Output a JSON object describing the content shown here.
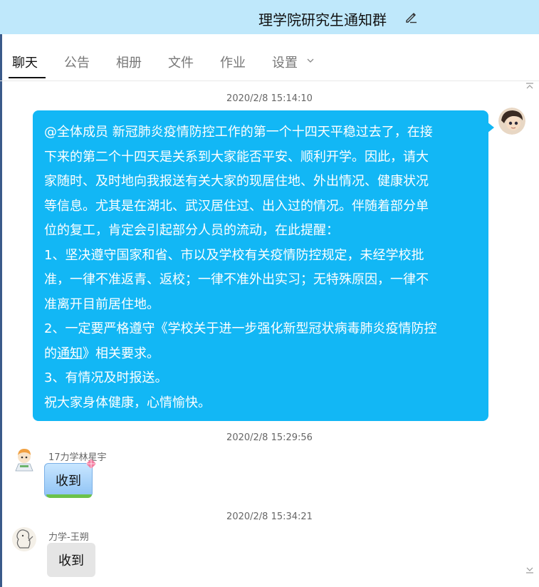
{
  "header": {
    "title": "理学院研究生通知群"
  },
  "tabs": [
    {
      "label": "聊天"
    },
    {
      "label": "公告"
    },
    {
      "label": "相册"
    },
    {
      "label": "文件"
    },
    {
      "label": "作业"
    },
    {
      "label": "设置"
    }
  ],
  "messages": [
    {
      "time": "2020/2/8 15:14:10",
      "lines": [
        "@全体成员 新冠肺炎疫情防控工作的第一个十四天平稳过去了，在接",
        "下来的第二个十四天是关系到大家能否平安、顺利开学。因此，请大",
        "家随时、及时地向我报送有关大家的现居住地、外出情况、健康状况",
        "等信息。尤其是在湖北、武汉居住过、出入过的情况。伴随着部分单",
        "位的复工，肯定会引起部分人员的流动，在此提醒：",
        "1、坚决遵守国家和省、市以及学校有关疫情防控规定，未经学校批",
        "准，一律不准返青、返校；一律不准外出实习；无特殊原因，一律不",
        "准离开目前居住地。",
        "2、一定要严格遵守《学校关于进一步强化新型冠状病毒肺炎疫情防控",
        "的",
        "通知",
        "》相关要求。",
        "3、有情况及时报送。",
        "祝大家身体健康，心情愉快。"
      ]
    },
    {
      "time": "2020/2/8 15:29:56",
      "sender": "17力学林星宇",
      "text": "收到"
    },
    {
      "time": "2020/2/8 15:34:21",
      "sender": "力学-王朔",
      "text": "收到"
    }
  ],
  "colors": {
    "titlebar": "#bfe8fb",
    "bubble": "#12b7f5"
  }
}
